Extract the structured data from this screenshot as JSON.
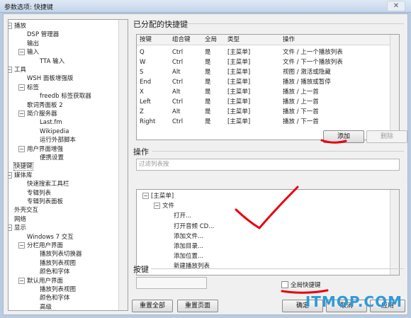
{
  "window": {
    "title": "参数选项: 快捷键",
    "close_glyph": "✕"
  },
  "tree": {
    "items": [
      {
        "label": "播放",
        "level": 0,
        "toggle": "−"
      },
      {
        "label": "DSP 管理器",
        "level": 1
      },
      {
        "label": "输出",
        "level": 1
      },
      {
        "label": "输入",
        "level": 1,
        "toggle": "−"
      },
      {
        "label": "TTA 输入",
        "level": 2
      },
      {
        "label": "工具",
        "level": 0,
        "toggle": "−"
      },
      {
        "label": "WSH 面板增强版",
        "level": 1
      },
      {
        "label": "标签",
        "level": 1,
        "toggle": "−"
      },
      {
        "label": "freedb 标签获取器",
        "level": 2
      },
      {
        "label": "歌词秀面板 2",
        "level": 1
      },
      {
        "label": "简介服务器",
        "level": 1,
        "toggle": "−"
      },
      {
        "label": "Last.fm",
        "level": 2
      },
      {
        "label": "Wikipedia",
        "level": 2
      },
      {
        "label": "运行外部脚本",
        "level": 2
      },
      {
        "label": "用户界面增强",
        "level": 1,
        "toggle": "−"
      },
      {
        "label": "便携设置",
        "level": 2
      },
      {
        "label": "快捷键",
        "level": 0,
        "selected": true
      },
      {
        "label": "媒体库",
        "level": 0,
        "toggle": "−"
      },
      {
        "label": "快速搜索工具栏",
        "level": 1
      },
      {
        "label": "专辑列表",
        "level": 1
      },
      {
        "label": "专辑列表面板",
        "level": 1
      },
      {
        "label": "外壳交互",
        "level": 0
      },
      {
        "label": "网络",
        "level": 0
      },
      {
        "label": "显示",
        "level": 0,
        "toggle": "−"
      },
      {
        "label": "Windows 7 交互",
        "level": 1
      },
      {
        "label": "分栏用户界面",
        "level": 1,
        "toggle": "−"
      },
      {
        "label": "播放列表切换器",
        "level": 2
      },
      {
        "label": "播放列表视图",
        "level": 2
      },
      {
        "label": "颜色和字体",
        "level": 2
      },
      {
        "label": "默认用户界面",
        "level": 1,
        "toggle": "−"
      },
      {
        "label": "播放列表视图",
        "level": 2
      },
      {
        "label": "颜色和字体",
        "level": 2
      },
      {
        "label": "高级",
        "level": 2
      }
    ]
  },
  "assigned": {
    "title": "已分配的快捷键",
    "columns": [
      "按键",
      "组合键",
      "全局",
      "类型",
      "操作"
    ],
    "rows": [
      [
        "Q",
        "Ctrl",
        "是",
        "[主菜单]",
        "文件 / 上一个播放列表"
      ],
      [
        "W",
        "Ctrl",
        "是",
        "[主菜单]",
        "文件 / 下一个播放列表"
      ],
      [
        "S",
        "Alt",
        "是",
        "[主菜单]",
        "视图 / 激活或隐藏"
      ],
      [
        "End",
        "Ctrl",
        "是",
        "[主菜单]",
        "播放 / 播放或暂停"
      ],
      [
        "X",
        "Alt",
        "是",
        "[主菜单]",
        "播放 / 上一首"
      ],
      [
        "Left",
        "Ctrl",
        "是",
        "[主菜单]",
        "播放 / 上一首"
      ],
      [
        "Z",
        "Alt",
        "是",
        "[主菜单]",
        "播放 / 下一首"
      ],
      [
        "Right",
        "Ctrl",
        "是",
        "[主菜单]",
        "播放 / 下一首"
      ]
    ],
    "add_label": "添加",
    "delete_label": "删除"
  },
  "operation": {
    "title": "操作",
    "filter_placeholder": "过滤列表按",
    "tree": [
      {
        "label": "[主菜单]",
        "level": 0,
        "toggle": "−"
      },
      {
        "label": "文件",
        "level": 1,
        "toggle": "−"
      },
      {
        "label": "打开...",
        "level": 2
      },
      {
        "label": "打开音频 CD...",
        "level": 2
      },
      {
        "label": "添加文件...",
        "level": 2
      },
      {
        "label": "添加目录...",
        "level": 2
      },
      {
        "label": "添加位置...",
        "level": 2
      },
      {
        "label": "新建播放列表",
        "level": 2
      }
    ]
  },
  "key": {
    "title": "按键",
    "global_label": "全局快捷键"
  },
  "footer": {
    "reset_all": "重置全部",
    "reset_page": "重置页面",
    "ok": "确定",
    "cancel": "取消",
    "apply": "应用"
  },
  "watermark": "ITMOP.COM",
  "colors": {
    "annotation_red": "#e8000b",
    "watermark": "#2f9ad8"
  }
}
